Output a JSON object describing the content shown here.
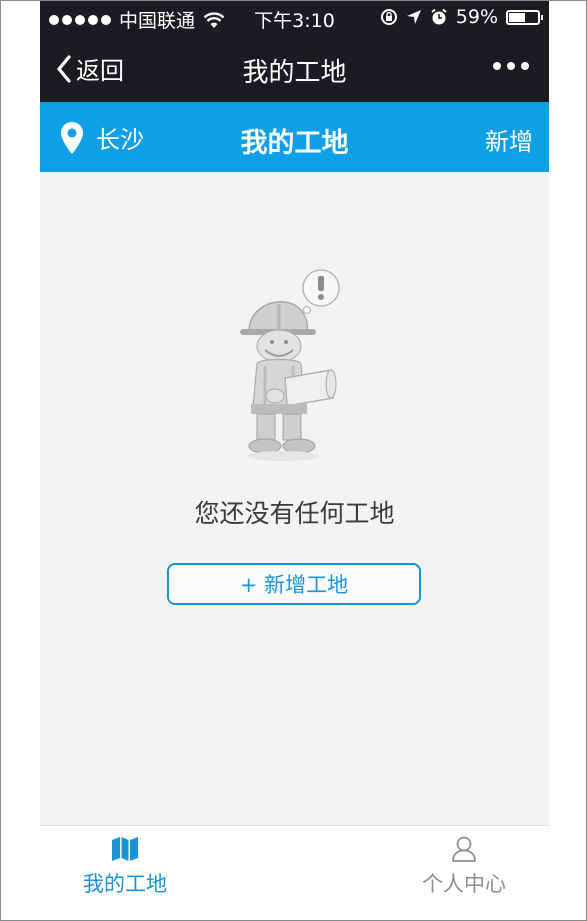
{
  "status_bar": {
    "carrier": "中国联通",
    "time": "下午3:10",
    "battery": "59%",
    "battery_level": 0.59
  },
  "nav": {
    "back_label": "返回",
    "title": "我的工地"
  },
  "header": {
    "city": "长沙",
    "title": "我的工地",
    "add_label": "新增"
  },
  "empty_state": {
    "message": "您还没有任何工地",
    "button_label": "+ 新增工地"
  },
  "tabs": [
    {
      "label": "我的工地",
      "icon": "map-icon",
      "active": true
    },
    {
      "label": "个人中心",
      "icon": "user-icon",
      "active": false
    }
  ],
  "colors": {
    "accent": "#0f9fe7",
    "tab_active": "#1a94d6",
    "tab_inactive": "#8e8e8e",
    "nav_bg": "#1b1c20"
  }
}
